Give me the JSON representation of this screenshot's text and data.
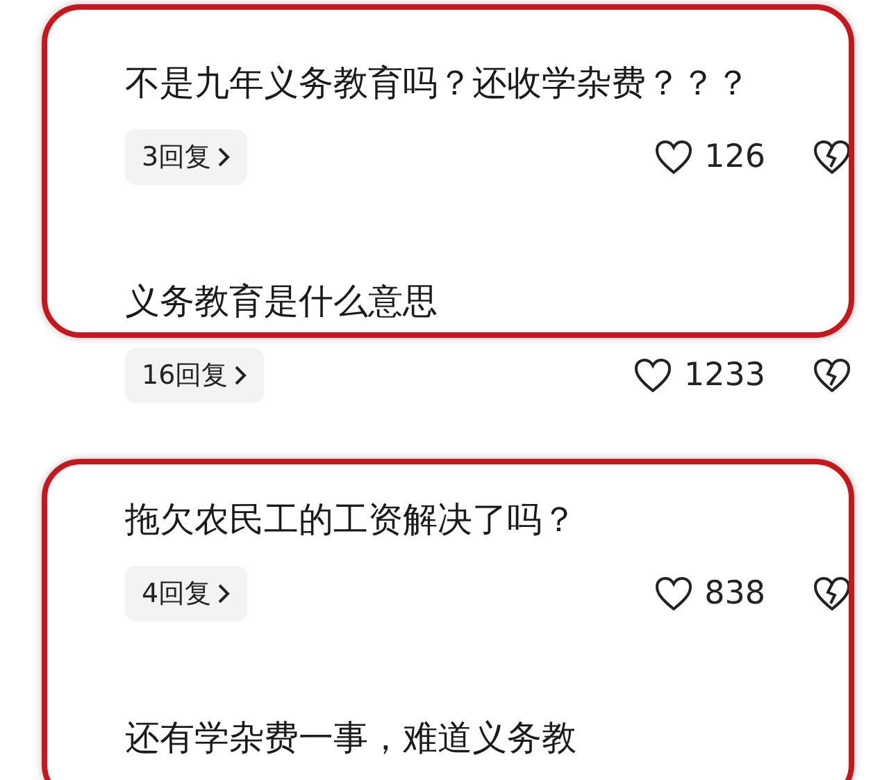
{
  "highlight_frames": [
    {
      "comments": [
        {
          "text": "不是九年义务教育吗？还收学杂费？？？",
          "replies": "3回复",
          "likes": "126"
        },
        {
          "text": "义务教育是什么意思",
          "replies": "16回复",
          "likes": "1233"
        }
      ]
    },
    {
      "comments": [
        {
          "text": "拖欠农民工的工资解决了吗？",
          "replies": "4回复",
          "likes": "838"
        },
        {
          "text": "还有学杂费一事，难道义务教"
        }
      ]
    }
  ]
}
